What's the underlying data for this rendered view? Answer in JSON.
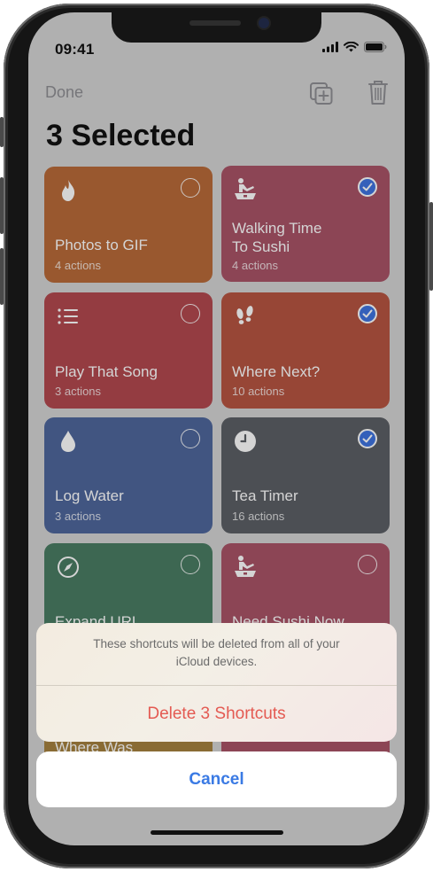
{
  "status_bar": {
    "time": "09:41"
  },
  "nav": {
    "done_label": "Done",
    "add_icon": "add-to-home-icon",
    "trash_icon": "trash-icon"
  },
  "title": "3 Selected",
  "shortcuts": [
    {
      "title_lines": [
        "Photos to GIF",
        ""
      ],
      "actions": "4 actions",
      "icon": "flame-icon",
      "color": "#b86a39",
      "selected": false
    },
    {
      "title_lines": [
        "Walking Time",
        "To Sushi"
      ],
      "actions": "4 actions",
      "icon": "sushi-chef-icon",
      "color": "#a95367",
      "selected": true
    },
    {
      "title_lines": [
        "Play That Song",
        ""
      ],
      "actions": "3 actions",
      "icon": "list-icon",
      "color": "#b2494f",
      "selected": false
    },
    {
      "title_lines": [
        "Where Next?",
        ""
      ],
      "actions": "10 actions",
      "icon": "footprints-icon",
      "color": "#b65542",
      "selected": true
    },
    {
      "title_lines": [
        "Log Water",
        ""
      ],
      "actions": "3 actions",
      "icon": "water-drop-icon",
      "color": "#4f679c",
      "selected": false
    },
    {
      "title_lines": [
        "Tea Timer",
        ""
      ],
      "actions": "16 actions",
      "icon": "clock-icon",
      "color": "#5c5f66",
      "selected": true
    },
    {
      "title_lines": [
        "Expand URL",
        ""
      ],
      "actions": "",
      "icon": "compass-icon",
      "color": "#4a7c63",
      "selected": false
    },
    {
      "title_lines": [
        "Need Sushi Now",
        ""
      ],
      "actions": "",
      "icon": "sushi-chef-icon",
      "color": "#a95367",
      "selected": false
    },
    {
      "title_lines": [
        "Where Was",
        ""
      ],
      "actions": "",
      "icon": "",
      "color": "#a5813f",
      "selected": false
    },
    {
      "title_lines": [
        "",
        ""
      ],
      "actions": "",
      "icon": "",
      "color": "#a95367",
      "selected": false
    }
  ],
  "action_sheet": {
    "message": "These shortcuts will be deleted from all of your iCloud devices.",
    "message_line1": "These shortcuts will be deleted from all of your",
    "message_line2": "iCloud devices.",
    "delete_label": "Delete 3 Shortcuts",
    "cancel_label": "Cancel"
  },
  "colors": {
    "destructive": "#e45a52",
    "accent": "#3a7ae4",
    "check_selected": "#3f74e0"
  }
}
